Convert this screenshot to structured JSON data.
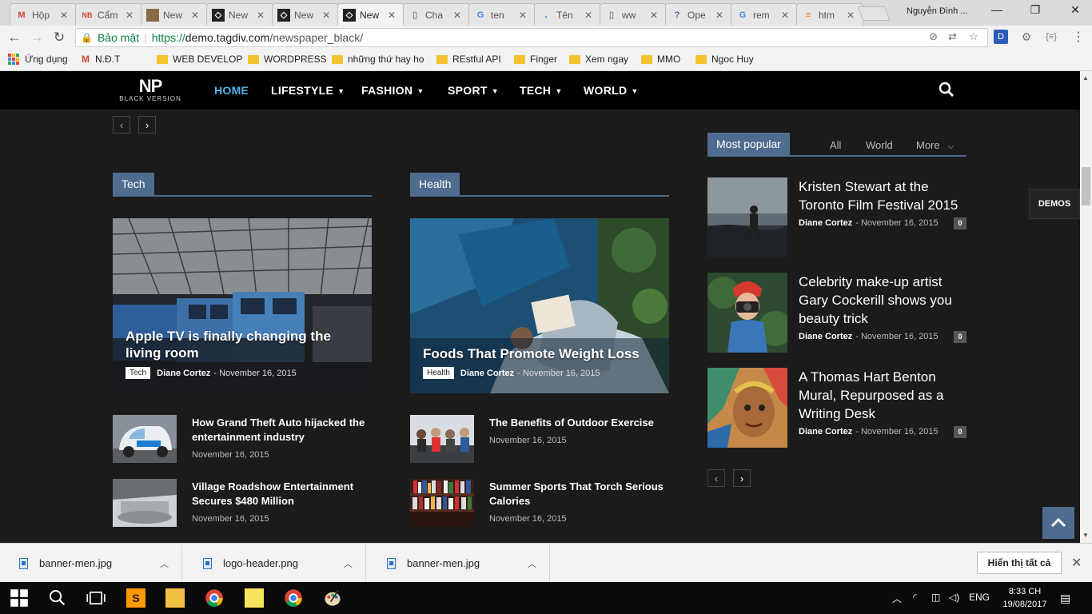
{
  "browser": {
    "tabs": [
      {
        "title": "Hộp",
        "icon": "gmail-icon",
        "color": "#d44638"
      },
      {
        "title": "Cẩm",
        "icon": "nbt-icon",
        "color": "#d44638"
      },
      {
        "title": "New",
        "icon": "image-icon",
        "color": "#8a6a45"
      },
      {
        "title": "New",
        "icon": "newspaper-icon",
        "color": "#222222"
      },
      {
        "title": "New",
        "icon": "newspaper-icon",
        "color": "#222222"
      },
      {
        "title": "New",
        "icon": "newspaper-icon",
        "color": "#222222"
      },
      {
        "title": "Cha",
        "icon": "doc-icon",
        "color": "#888888"
      },
      {
        "title": "ten",
        "icon": "google-icon",
        "color": "#4285f4"
      },
      {
        "title": "Tên",
        "icon": "dot-icon",
        "color": "#1a73e8"
      },
      {
        "title": "ww",
        "icon": "doc-icon",
        "color": "#888888"
      },
      {
        "title": "Ope",
        "icon": "opera-icon",
        "color": "#7b4ea0"
      },
      {
        "title": "rem",
        "icon": "google-icon",
        "color": "#4285f4"
      },
      {
        "title": "htm",
        "icon": "stack-icon",
        "color": "#f48024"
      }
    ],
    "user_name": "Nguyễn Đình ...",
    "url": {
      "secure_label": "Bảo mật",
      "scheme": "https://",
      "host": "demo.tagdiv.com",
      "path": "/newspaper_black/"
    },
    "bookmarks": [
      {
        "label": "Ứng dụng",
        "icon": "apps-icon"
      },
      {
        "label": "N.Đ.T",
        "icon": "gmail-icon"
      },
      {
        "label": "WEB DEVELOP",
        "icon": "folder-icon"
      },
      {
        "label": "WORDPRESS",
        "icon": "folder-icon"
      },
      {
        "label": "những thứ hay ho",
        "icon": "folder-icon"
      },
      {
        "label": "REstful API",
        "icon": "folder-icon"
      },
      {
        "label": "Finger",
        "icon": "folder-icon"
      },
      {
        "label": "Xem ngay",
        "icon": "folder-icon"
      },
      {
        "label": "MMO",
        "icon": "folder-icon"
      },
      {
        "label": "Ngoc Huy",
        "icon": "folder-icon"
      }
    ]
  },
  "site": {
    "logo": {
      "main": "NP",
      "sub": "BLACK VERSION"
    },
    "menu": [
      {
        "label": "HOME",
        "active": true,
        "dropdown": false
      },
      {
        "label": "LIFESTYLE",
        "active": false,
        "dropdown": true
      },
      {
        "label": "FASHION",
        "active": false,
        "dropdown": true
      },
      {
        "label": "SPORT",
        "active": false,
        "dropdown": true
      },
      {
        "label": "TECH",
        "active": false,
        "dropdown": true
      },
      {
        "label": "WORLD",
        "active": false,
        "dropdown": true
      }
    ],
    "blocks": [
      {
        "heading": "Tech",
        "featured": {
          "title": "Apple TV is finally changing the living room",
          "category": "Tech",
          "author": "Diane Cortez",
          "date": "November 16, 2015"
        },
        "posts": [
          {
            "title": "How Grand Theft Auto hijacked the entertainment industry",
            "date": "November 16, 2015"
          },
          {
            "title": "Village Roadshow Entertainment Secures $480 Million",
            "date": "November 16, 2015"
          }
        ]
      },
      {
        "heading": "Health",
        "featured": {
          "title": "Foods That Promote Weight Loss",
          "category": "Health",
          "author": "Diane Cortez",
          "date": "November 16, 2015"
        },
        "posts": [
          {
            "title": "The Benefits of Outdoor Exercise",
            "date": "November 16, 2015"
          },
          {
            "title": "Summer Sports That Torch Serious Calories",
            "date": "November 16, 2015"
          }
        ]
      }
    ],
    "popular": {
      "heading": "Most popular",
      "filters": [
        "All",
        "World",
        "More"
      ],
      "items": [
        {
          "title": "Kristen Stewart at the Toronto Film Festival 2015",
          "author": "Diane Cortez",
          "date": "November 16, 2015",
          "comments": "0"
        },
        {
          "title": "Celebrity make-up artist Gary Cockerill shows you beauty trick",
          "author": "Diane Cortez",
          "date": "November 16, 2015",
          "comments": "0"
        },
        {
          "title": "A Thomas Hart Benton Mural, Repurposed as a Writing Desk",
          "author": "Diane Cortez",
          "date": "November 16, 2015",
          "comments": "0"
        }
      ]
    },
    "demos_label": "DEMOS",
    "accent": "#4e6c8e",
    "menu_active_color": "#4db2ec"
  },
  "downloads": {
    "items": [
      "banner-men.jpg",
      "logo-header.png",
      "banner-men.jpg"
    ],
    "show_all": "Hiển thị tất cả"
  },
  "taskbar": {
    "language": "ENG",
    "time": "8:33 CH",
    "date": "19/08/2017"
  }
}
